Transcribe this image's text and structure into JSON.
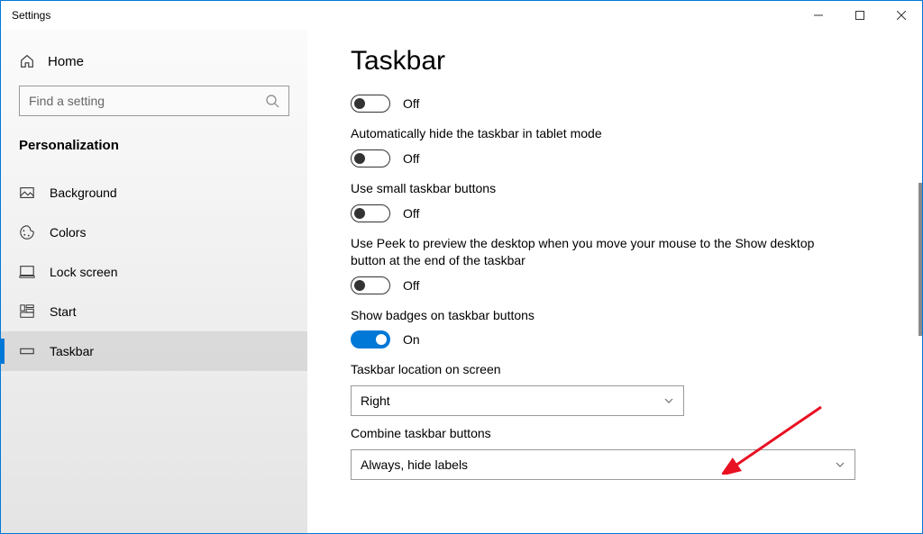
{
  "window": {
    "title": "Settings"
  },
  "sidebar": {
    "home": "Home",
    "search_placeholder": "Find a setting",
    "category": "Personalization",
    "items": [
      {
        "label": "Background"
      },
      {
        "label": "Colors"
      },
      {
        "label": "Lock screen"
      },
      {
        "label": "Start"
      },
      {
        "label": "Taskbar"
      }
    ]
  },
  "main": {
    "heading": "Taskbar",
    "toggle1_state": "Off",
    "setting2_label": "Automatically hide the taskbar in tablet mode",
    "toggle2_state": "Off",
    "setting3_label": "Use small taskbar buttons",
    "toggle3_state": "Off",
    "setting4_label": "Use Peek to preview the desktop when you move your mouse to the Show desktop button at the end of the taskbar",
    "toggle4_state": "Off",
    "setting5_label": "Show badges on taskbar buttons",
    "toggle5_state": "On",
    "location_label": "Taskbar location on screen",
    "location_value": "Right",
    "combine_label": "Combine taskbar buttons",
    "combine_value": "Always, hide labels"
  }
}
